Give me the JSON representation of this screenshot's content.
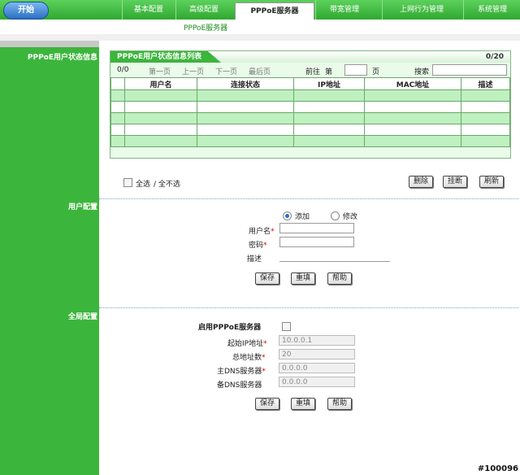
{
  "nav": {
    "start": "开始",
    "tabs": [
      "基本配置",
      "高级配置",
      "PPPoE服务器",
      "带宽管理",
      "上网行为管理",
      "系统管理"
    ],
    "subtab": "PPPoE服务器"
  },
  "sections": {
    "status": "PPPoE用户状态信息",
    "user": "用户配置",
    "global": "全局配置"
  },
  "panel": {
    "title": "PPPoE用户状态信息列表",
    "count": "0/20",
    "pager": {
      "current": "0/0",
      "first": "第一页",
      "prev": "上一页",
      "next": "下一页",
      "last": "最后页",
      "goto": "前往",
      "page_prefix": "第",
      "page_suffix": "页",
      "search": "搜索"
    },
    "columns": [
      "用户名",
      "连接状态",
      "IP地址",
      "MAC地址",
      "描述"
    ],
    "rows": 5
  },
  "list_actions": {
    "select_all": "全选",
    "deselect_all": "/ 全不选",
    "delete": "删除",
    "hangup": "挂断",
    "refresh": "刷新"
  },
  "user_config": {
    "mode_add": "添加",
    "mode_edit": "修改",
    "username_label": "用户名",
    "password_label": "密码",
    "desc_label": "描述",
    "save": "保存",
    "reset": "重填",
    "help": "帮助"
  },
  "global_config": {
    "enable_label": "启用PPPoE服务器",
    "start_ip_label": "起始IP地址",
    "start_ip": "10.0.0.1",
    "total_label": "总地址数",
    "total": "20",
    "dns1_label": "主DNS服务器",
    "dns1": "0.0.0.0",
    "dns2_label": "备DNS服务器",
    "dns2": "0.0.0.0",
    "save": "保存",
    "reset": "重填",
    "help": "帮助"
  },
  "watermark": "#100096"
}
